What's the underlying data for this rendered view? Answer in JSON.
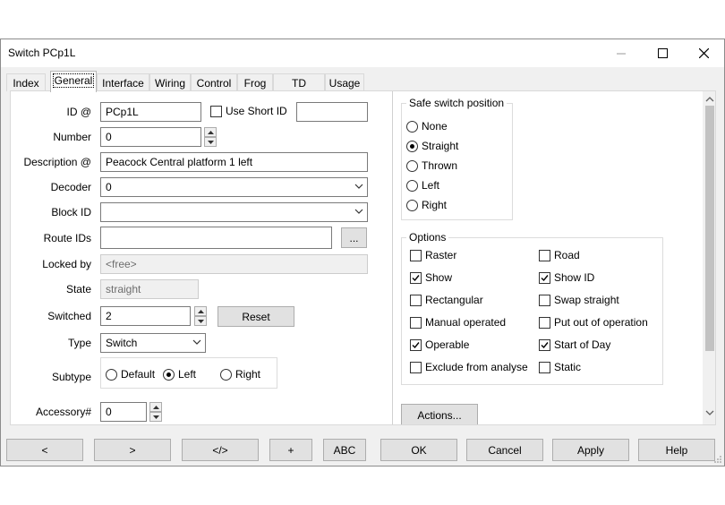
{
  "window": {
    "title": "Switch PCp1L",
    "min_icon": "minimize-icon",
    "max_icon": "maximize-icon",
    "close_icon": "close-icon"
  },
  "tabs": [
    "Index",
    "General",
    "Interface",
    "Wiring",
    "Control",
    "Frog",
    "TD",
    "Usage"
  ],
  "active_tab": "General",
  "form": {
    "id_label": "ID @",
    "id_value": "PCp1L",
    "use_short_id_label": "Use Short ID",
    "short_id_value": "",
    "number_label": "Number",
    "number_value": "0",
    "description_label": "Description @",
    "description_value": "Peacock Central platform 1 left",
    "decoder_label": "Decoder",
    "decoder_value": "0",
    "block_id_label": "Block ID",
    "block_id_value": "",
    "route_ids_label": "Route IDs",
    "route_ids_value": "",
    "route_ids_button": "...",
    "locked_by_label": "Locked by",
    "locked_by_value": "<free>",
    "state_label": "State",
    "state_value": "straight",
    "switched_label": "Switched",
    "switched_value": "2",
    "reset_button": "Reset",
    "type_label": "Type",
    "type_value": "Switch",
    "subtype_label": "Subtype",
    "subtype_options": [
      "Default",
      "Left",
      "Right"
    ],
    "subtype_selected": "Left",
    "accessory_label": "Accessory#",
    "accessory_value": "0"
  },
  "safe_position": {
    "title": "Safe switch position",
    "options": [
      "None",
      "Straight",
      "Thrown",
      "Left",
      "Right"
    ],
    "selected": "Straight"
  },
  "options": {
    "title": "Options",
    "left": [
      {
        "label": "Raster",
        "checked": false
      },
      {
        "label": "Show",
        "checked": true
      },
      {
        "label": "Rectangular",
        "checked": false
      },
      {
        "label": "Manual operated",
        "checked": false
      },
      {
        "label": "Operable",
        "checked": true
      },
      {
        "label": "Exclude from analyse",
        "checked": false
      }
    ],
    "right": [
      {
        "label": "Road",
        "checked": false
      },
      {
        "label": "Show ID",
        "checked": true
      },
      {
        "label": "Swap straight",
        "checked": false
      },
      {
        "label": "Put out of operation",
        "checked": false
      },
      {
        "label": "Start of Day",
        "checked": true
      },
      {
        "label": "Static",
        "checked": false
      }
    ]
  },
  "actions_button": "Actions...",
  "bottom_buttons": [
    "<",
    ">",
    "</>",
    "+",
    "ABC",
    "OK",
    "Cancel",
    "Apply",
    "Help"
  ]
}
